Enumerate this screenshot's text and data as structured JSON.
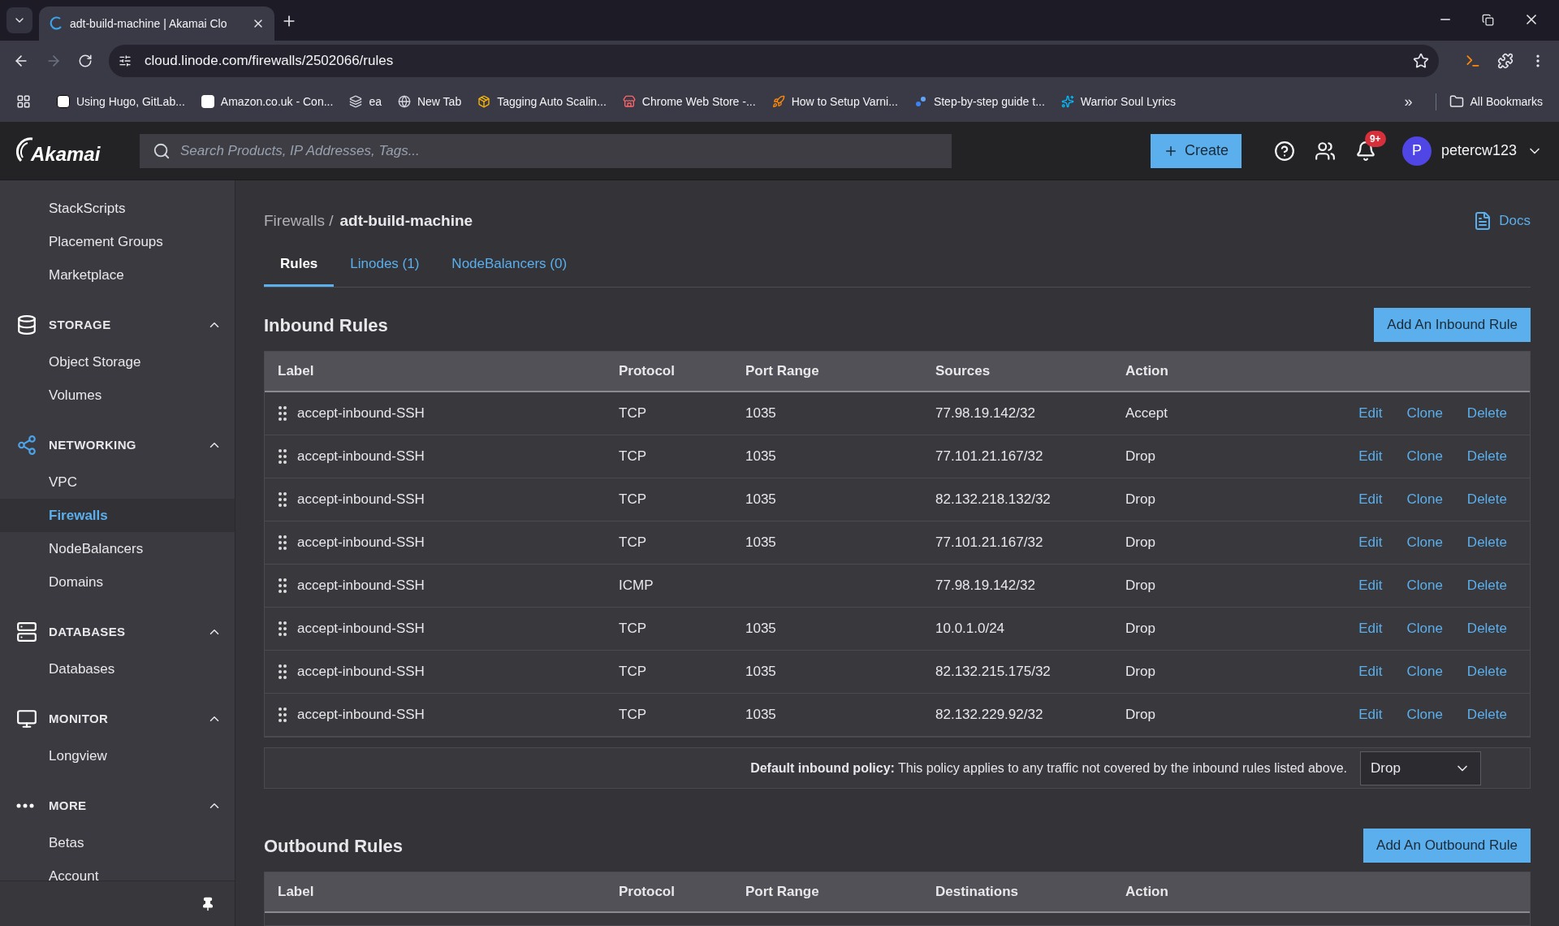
{
  "browser": {
    "tabs": [
      {
        "title": "adt-build-machine | Akamai Clo",
        "selected": true
      }
    ],
    "url": "cloud.linode.com/firewalls/2502066/rules",
    "bookmarks": [
      {
        "label": "Using Hugo, GitLab..."
      },
      {
        "label": "Amazon.co.uk - Con..."
      },
      {
        "label": "ea"
      },
      {
        "label": "New Tab"
      },
      {
        "label": "Tagging Auto Scalin..."
      },
      {
        "label": "Chrome Web Store -..."
      },
      {
        "label": "How to Setup Varni..."
      },
      {
        "label": "Step-by-step guide t..."
      },
      {
        "label": "Warrior Soul Lyrics"
      }
    ],
    "overflow": "»",
    "all_bookmarks": "All Bookmarks"
  },
  "header": {
    "logo": "Akamai",
    "search_placeholder": "Search Products, IP Addresses, Tags...",
    "create": "Create",
    "notifications": "9+",
    "avatar": "P",
    "user": "petercw123"
  },
  "sidebar": {
    "sections": [
      {
        "items": [
          {
            "label": "StackScripts",
            "selected": false
          },
          {
            "label": "Placement Groups",
            "selected": false
          },
          {
            "label": "Marketplace",
            "selected": false
          }
        ]
      },
      {
        "title": "STORAGE",
        "expanded": true,
        "items": [
          {
            "label": "Object Storage",
            "selected": false
          },
          {
            "label": "Volumes",
            "selected": false
          }
        ]
      },
      {
        "title": "NETWORKING",
        "expanded": true,
        "items": [
          {
            "label": "VPC",
            "selected": false
          },
          {
            "label": "Firewalls",
            "selected": true
          },
          {
            "label": "NodeBalancers",
            "selected": false
          },
          {
            "label": "Domains",
            "selected": false
          }
        ]
      },
      {
        "title": "DATABASES",
        "expanded": true,
        "items": [
          {
            "label": "Databases",
            "selected": false
          }
        ]
      },
      {
        "title": "MONITOR",
        "expanded": true,
        "items": [
          {
            "label": "Longview",
            "selected": false
          }
        ]
      },
      {
        "title": "MORE",
        "expanded": true,
        "items": [
          {
            "label": "Betas",
            "selected": false
          },
          {
            "label": "Account",
            "selected": false
          }
        ]
      }
    ]
  },
  "breadcrumb": {
    "parent": "Firewalls /",
    "current": "adt-build-machine"
  },
  "docs": "Docs",
  "tabs": [
    {
      "label": "Rules",
      "selected": true
    },
    {
      "label": "Linodes (1)",
      "selected": false
    },
    {
      "label": "NodeBalancers (0)",
      "selected": false
    }
  ],
  "inbound": {
    "title": "Inbound Rules",
    "add_button": "Add An Inbound Rule",
    "columns": [
      "Label",
      "Protocol",
      "Port Range",
      "Sources",
      "Action"
    ],
    "rows": [
      {
        "label": "accept-inbound-SSH",
        "protocol": "TCP",
        "ports": "1035",
        "address": "77.98.19.142/32",
        "action": "Accept",
        "actions": [
          "Edit",
          "Clone",
          "Delete"
        ]
      },
      {
        "label": "accept-inbound-SSH",
        "protocol": "TCP",
        "ports": "1035",
        "address": "77.101.21.167/32",
        "action": "Drop",
        "actions": [
          "Edit",
          "Clone",
          "Delete"
        ]
      },
      {
        "label": "accept-inbound-SSH",
        "protocol": "TCP",
        "ports": "1035",
        "address": "82.132.218.132/32",
        "action": "Drop",
        "actions": [
          "Edit",
          "Clone",
          "Delete"
        ]
      },
      {
        "label": "accept-inbound-SSH",
        "protocol": "TCP",
        "ports": "1035",
        "address": "77.101.21.167/32",
        "action": "Drop",
        "actions": [
          "Edit",
          "Clone",
          "Delete"
        ]
      },
      {
        "label": "accept-inbound-SSH",
        "protocol": "ICMP",
        "address": "77.98.19.142/32",
        "action": "Drop",
        "actions": [
          "Edit",
          "Clone",
          "Delete"
        ]
      },
      {
        "label": "accept-inbound-SSH",
        "protocol": "TCP",
        "ports": "1035",
        "address": "10.0.1.0/24",
        "action": "Drop",
        "actions": [
          "Edit",
          "Clone",
          "Delete"
        ]
      },
      {
        "label": "accept-inbound-SSH",
        "protocol": "TCP",
        "ports": "1035",
        "address": "82.132.215.175/32",
        "action": "Drop",
        "actions": [
          "Edit",
          "Clone",
          "Delete"
        ]
      },
      {
        "label": "accept-inbound-SSH",
        "protocol": "TCP",
        "ports": "1035",
        "address": "82.132.229.92/32",
        "action": "Drop",
        "actions": [
          "Edit",
          "Clone",
          "Delete"
        ]
      }
    ],
    "policy_text": "**Default inbound policy:** This policy applies to any traffic not covered by the inbound rules listed above.",
    "policy_value": "Drop"
  },
  "outbound": {
    "title": "Outbound Rules",
    "add_button": "Add An Outbound Rule",
    "columns": [
      "Label",
      "Protocol",
      "Port Range",
      "Destinations",
      "Action"
    ]
  }
}
